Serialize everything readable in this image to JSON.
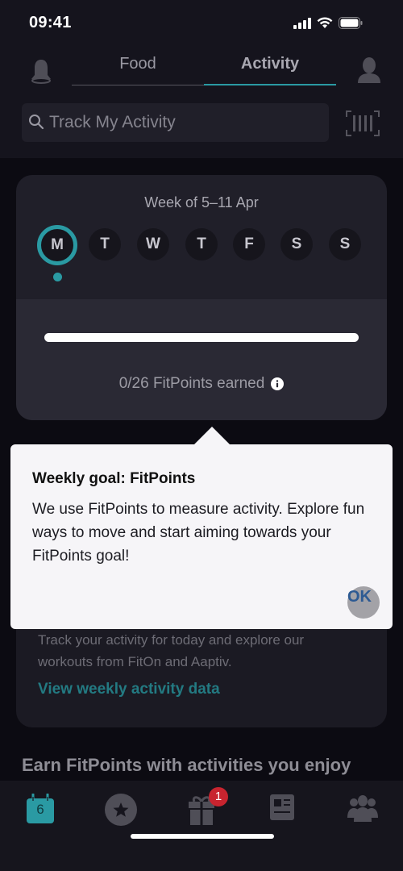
{
  "status_bar": {
    "time": "09:41"
  },
  "header": {
    "tabs": [
      {
        "label": "Food",
        "active": false
      },
      {
        "label": "Activity",
        "active": true
      }
    ],
    "search": {
      "placeholder": "Track My Activity"
    }
  },
  "week_card": {
    "week_label": "Week of 5–11 Apr",
    "days": [
      {
        "label": "M",
        "selected": true
      },
      {
        "label": "T",
        "selected": false
      },
      {
        "label": "W",
        "selected": false
      },
      {
        "label": "T",
        "selected": false
      },
      {
        "label": "F",
        "selected": false
      },
      {
        "label": "S",
        "selected": false
      },
      {
        "label": "S",
        "selected": false
      }
    ],
    "progress_fraction": 0,
    "points_text": "0/26 FitPoints earned"
  },
  "activity_card": {
    "description": "Track your activity for today and explore our workouts from FitOn and Aaptiv.",
    "link": "View weekly activity data"
  },
  "section_title": "Earn FitPoints with activities you enjoy",
  "tooltip": {
    "title": "Weekly goal: FitPoints",
    "body": "We use FitPoints to measure activity. Explore fun ways to move and start aiming towards your FitPoints goal!",
    "ok_label": "OK"
  },
  "bottom_nav": {
    "calendar_day": "6",
    "rewards_badge": "1",
    "items": [
      "calendar",
      "favorites",
      "rewards",
      "articles",
      "community"
    ]
  },
  "colors": {
    "accent": "#2a9aa3",
    "background": "#0c0b12",
    "card": "#201f29",
    "badge": "#c8242f"
  }
}
